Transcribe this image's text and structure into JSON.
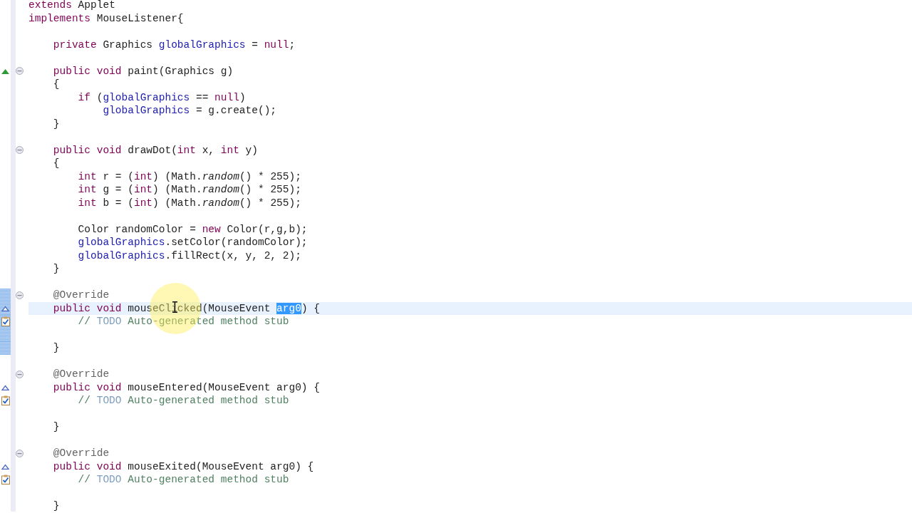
{
  "editor": {
    "lines": [
      {
        "current": false,
        "in_range": false,
        "tokens": [
          {
            "kind": "kw",
            "text": "extends"
          },
          {
            "kind": "plain",
            "text": " Applet"
          }
        ]
      },
      {
        "current": false,
        "in_range": false,
        "tokens": [
          {
            "kind": "kw",
            "text": "implements"
          },
          {
            "kind": "plain",
            "text": " MouseListener{"
          }
        ]
      },
      {
        "current": false,
        "in_range": false
      },
      {
        "current": false,
        "in_range": false,
        "tokens": [
          {
            "kind": "kw",
            "text": "    private"
          },
          {
            "kind": "plain",
            "text": " Graphics "
          },
          {
            "kind": "field",
            "text": "globalGraphics"
          },
          {
            "kind": "plain",
            "text": " = "
          },
          {
            "kind": "kw",
            "text": "null"
          },
          {
            "kind": "plain",
            "text": ";"
          }
        ]
      },
      {
        "current": false,
        "in_range": false
      },
      {
        "current": false,
        "in_range": false,
        "markers": [
          {
            "kind": "overrides"
          },
          {
            "kind": "fold"
          }
        ],
        "tokens": [
          {
            "kind": "kw",
            "text": "    public void"
          },
          {
            "kind": "plain",
            "text": " paint(Graphics g)"
          }
        ]
      },
      {
        "current": false,
        "in_range": false,
        "tokens": [
          {
            "kind": "plain",
            "text": "    {"
          }
        ]
      },
      {
        "current": false,
        "in_range": false,
        "tokens": [
          {
            "kind": "kw",
            "text": "        if"
          },
          {
            "kind": "plain",
            "text": " ("
          },
          {
            "kind": "field",
            "text": "globalGraphics"
          },
          {
            "kind": "plain",
            "text": " == "
          },
          {
            "kind": "kw",
            "text": "null"
          },
          {
            "kind": "plain",
            "text": ")"
          }
        ]
      },
      {
        "current": false,
        "in_range": false,
        "tokens": [
          {
            "kind": "field",
            "text": "            globalGraphics"
          },
          {
            "kind": "plain",
            "text": " = g.create();"
          }
        ]
      },
      {
        "current": false,
        "in_range": false,
        "tokens": [
          {
            "kind": "plain",
            "text": "    }"
          }
        ]
      },
      {
        "current": false,
        "in_range": false
      },
      {
        "current": false,
        "in_range": false,
        "markers": [
          {
            "kind": "fold"
          }
        ],
        "tokens": [
          {
            "kind": "kw",
            "text": "    public void"
          },
          {
            "kind": "plain",
            "text": " drawDot("
          },
          {
            "kind": "kw",
            "text": "int"
          },
          {
            "kind": "plain",
            "text": " x, "
          },
          {
            "kind": "kw",
            "text": "int"
          },
          {
            "kind": "plain",
            "text": " y)"
          }
        ]
      },
      {
        "current": false,
        "in_range": false,
        "tokens": [
          {
            "kind": "plain",
            "text": "    {"
          }
        ]
      },
      {
        "current": false,
        "in_range": false,
        "tokens": [
          {
            "kind": "kw",
            "text": "        int"
          },
          {
            "kind": "plain",
            "text": " r = ("
          },
          {
            "kind": "kw",
            "text": "int"
          },
          {
            "kind": "plain",
            "text": ") (Math."
          },
          {
            "kind": "italic",
            "text": "random"
          },
          {
            "kind": "plain",
            "text": "() * 255);"
          }
        ]
      },
      {
        "current": false,
        "in_range": false,
        "tokens": [
          {
            "kind": "kw",
            "text": "        int"
          },
          {
            "kind": "plain",
            "text": " g = ("
          },
          {
            "kind": "kw",
            "text": "int"
          },
          {
            "kind": "plain",
            "text": ") (Math."
          },
          {
            "kind": "italic",
            "text": "random"
          },
          {
            "kind": "plain",
            "text": "() * 255);"
          }
        ]
      },
      {
        "current": false,
        "in_range": false,
        "tokens": [
          {
            "kind": "kw",
            "text": "        int"
          },
          {
            "kind": "plain",
            "text": " b = ("
          },
          {
            "kind": "kw",
            "text": "int"
          },
          {
            "kind": "plain",
            "text": ") (Math."
          },
          {
            "kind": "italic",
            "text": "random"
          },
          {
            "kind": "plain",
            "text": "() * 255);"
          }
        ]
      },
      {
        "current": false,
        "in_range": false
      },
      {
        "current": false,
        "in_range": false,
        "tokens": [
          {
            "kind": "plain",
            "text": "        Color randomColor = "
          },
          {
            "kind": "kw",
            "text": "new"
          },
          {
            "kind": "plain",
            "text": " Color(r,g,b);"
          }
        ]
      },
      {
        "current": false,
        "in_range": false,
        "tokens": [
          {
            "kind": "field",
            "text": "        globalGraphics"
          },
          {
            "kind": "plain",
            "text": ".setColor(randomColor);"
          }
        ]
      },
      {
        "current": false,
        "in_range": false,
        "tokens": [
          {
            "kind": "field",
            "text": "        globalGraphics"
          },
          {
            "kind": "plain",
            "text": ".fillRect(x, y, 2, 2);"
          }
        ]
      },
      {
        "current": false,
        "in_range": false,
        "tokens": [
          {
            "kind": "plain",
            "text": "    }"
          }
        ]
      },
      {
        "current": false,
        "in_range": false
      },
      {
        "current": false,
        "in_range": true,
        "markers": [
          {
            "kind": "fold"
          }
        ],
        "tokens": [
          {
            "kind": "ann",
            "text": "    @Override"
          }
        ]
      },
      {
        "current": true,
        "in_range": true,
        "markers": [
          {
            "kind": "implements"
          }
        ],
        "tokens": [
          {
            "kind": "kw",
            "text": "    public void"
          },
          {
            "kind": "plain",
            "text": " mouseClicked(MouseEvent "
          },
          {
            "kind": "sel",
            "text": "arg0"
          },
          {
            "kind": "plain",
            "text": ") {"
          }
        ]
      },
      {
        "current": false,
        "in_range": true,
        "markers": [
          {
            "kind": "task"
          }
        ],
        "tokens": [
          {
            "kind": "comment",
            "text": "        // "
          },
          {
            "kind": "todo",
            "text": "TODO"
          },
          {
            "kind": "comment",
            "text": " Auto-generated method stub"
          }
        ]
      },
      {
        "current": false,
        "in_range": true
      },
      {
        "current": false,
        "in_range": true,
        "tokens": [
          {
            "kind": "plain",
            "text": "    }"
          }
        ]
      },
      {
        "current": false,
        "in_range": false
      },
      {
        "current": false,
        "in_range": false,
        "markers": [
          {
            "kind": "fold"
          }
        ],
        "tokens": [
          {
            "kind": "ann",
            "text": "    @Override"
          }
        ]
      },
      {
        "current": false,
        "in_range": false,
        "markers": [
          {
            "kind": "implements"
          }
        ],
        "tokens": [
          {
            "kind": "kw",
            "text": "    public void"
          },
          {
            "kind": "plain",
            "text": " mouseEntered(MouseEvent arg0) {"
          }
        ]
      },
      {
        "current": false,
        "in_range": false,
        "markers": [
          {
            "kind": "task"
          }
        ],
        "tokens": [
          {
            "kind": "comment",
            "text": "        // "
          },
          {
            "kind": "todo",
            "text": "TODO"
          },
          {
            "kind": "comment",
            "text": " Auto-generated method stub"
          }
        ]
      },
      {
        "current": false,
        "in_range": false
      },
      {
        "current": false,
        "in_range": false,
        "tokens": [
          {
            "kind": "plain",
            "text": "    }"
          }
        ]
      },
      {
        "current": false,
        "in_range": false
      },
      {
        "current": false,
        "in_range": false,
        "markers": [
          {
            "kind": "fold"
          }
        ],
        "tokens": [
          {
            "kind": "ann",
            "text": "    @Override"
          }
        ]
      },
      {
        "current": false,
        "in_range": false,
        "markers": [
          {
            "kind": "implements"
          }
        ],
        "tokens": [
          {
            "kind": "kw",
            "text": "    public void"
          },
          {
            "kind": "plain",
            "text": " mouseExited(MouseEvent arg0) {"
          }
        ]
      },
      {
        "current": false,
        "in_range": false,
        "markers": [
          {
            "kind": "task"
          }
        ],
        "tokens": [
          {
            "kind": "comment",
            "text": "        // "
          },
          {
            "kind": "todo",
            "text": "TODO"
          },
          {
            "kind": "comment",
            "text": " Auto-generated method stub"
          }
        ]
      },
      {
        "current": false,
        "in_range": false
      },
      {
        "current": false,
        "in_range": false,
        "tokens": [
          {
            "kind": "plain",
            "text": "    }"
          }
        ]
      }
    ]
  }
}
